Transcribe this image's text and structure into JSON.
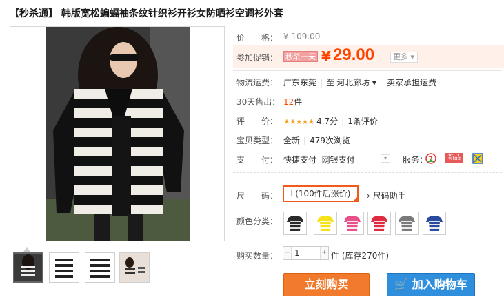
{
  "product": {
    "title": "【秒杀通】 韩版宽松蝙蝠袖条纹针织衫开衫女防晒衫空调衫外套"
  },
  "price": {
    "label": "价　　格：",
    "original": "¥ 109.00"
  },
  "promo": {
    "label": "参加促销：",
    "tag": "秒杀一天",
    "currency": "¥",
    "price": "29.00",
    "more": "更多 ▾"
  },
  "shipping": {
    "label": "物流运费：",
    "from": "广东东莞",
    "to_prefix": "至",
    "to": "河北廊坊 ▾",
    "fee": "卖家承担运费"
  },
  "sales": {
    "label": "30天售出：",
    "count": "12",
    "unit": "件"
  },
  "rating": {
    "label": "评　　价：",
    "stars": "★★★★★",
    "score": "4.7分",
    "reviews": "1条评价"
  },
  "item_type": {
    "label": "宝贝类型：",
    "condition": "全新",
    "views": "479次浏览"
  },
  "payment": {
    "label": "支　　付：",
    "method1": "快捷支付",
    "method2": "网银支付",
    "service_label": "服务：",
    "new_badge": "新品"
  },
  "size": {
    "label": "尺　　码：",
    "selected": "L(100件后涨价)",
    "helper": "尺码助手"
  },
  "color": {
    "label": "颜色分类：",
    "swatches": [
      "#2a2a2a",
      "#f5e21a",
      "#e8508a",
      "#e02a40",
      "#7a7a7a",
      "#2a4aa0"
    ]
  },
  "quantity": {
    "label": "购买数量：",
    "value": "1",
    "stock": "件 (库存270件)"
  },
  "buttons": {
    "buy": "立刻购买",
    "cart": "加入购物车"
  }
}
